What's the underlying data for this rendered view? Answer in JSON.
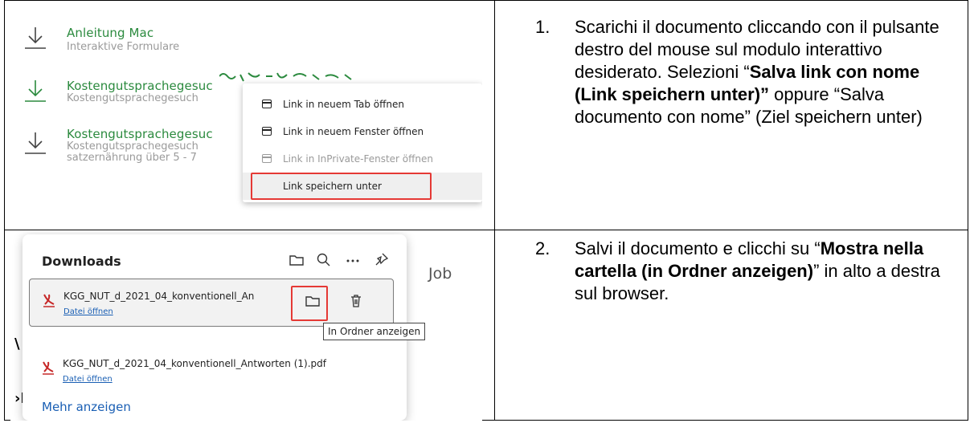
{
  "colors": {
    "accent_green": "#2b8a3e",
    "highlight_red": "#e53935",
    "link_blue": "#1a5fb4"
  },
  "screenshot1": {
    "downloads": [
      {
        "title": "Anleitung Mac",
        "subtitle_lines": [
          "Interaktive Formulare"
        ],
        "icon": "download-icon"
      },
      {
        "title": "Kostengutsprachegesuc",
        "subtitle_lines": [
          "Kostengutsprachegesuch"
        ],
        "icon": "download-icon"
      },
      {
        "title": "Kostengutsprachegesuc",
        "subtitle_lines": [
          "Kostengutsprachegesuch",
          "satzernährung über 5 - 7"
        ],
        "icon": "download-icon"
      }
    ],
    "context_menu": {
      "items": [
        {
          "label": "Link in neuem Tab öffnen",
          "icon": "tab-icon"
        },
        {
          "label": "Link in neuem Fenster öffnen",
          "icon": "window-icon"
        },
        {
          "label": "Link in InPrivate-Fenster öffnen",
          "icon": "inprivate-icon",
          "disabled": true
        },
        {
          "label": "Link speichern unter",
          "highlighted": true
        }
      ]
    }
  },
  "screenshot2": {
    "panel_title": "Downloads",
    "toolbar_icons": [
      "folder-icon",
      "search-icon",
      "more-icon",
      "pin-icon"
    ],
    "background_text": "Job",
    "files": [
      {
        "name": "KGG_NUT_d_2021_04_konventionell_An",
        "action": "Datei öffnen",
        "icon": "pdf-icon"
      },
      {
        "name": "KGG_NUT_d_2021_04_konventionell_Antworten (1).pdf",
        "action": "Datei öffnen",
        "icon": "pdf-icon"
      }
    ],
    "tooltip": "In Ordner anzeigen",
    "more_label": "Mehr anzeigen"
  },
  "instructions": [
    {
      "number": "1.",
      "part1": "Scarichi il documento cliccando con il pulsante destro del mouse sul modulo interattivo desiderato. Selezioni “",
      "bold": "Salva link con nome (Link speichern unter)”",
      "part2": " oppure “Salva documento con nome” (Ziel speichern unter)"
    },
    {
      "number": "2.",
      "part1": "Salvi il documento e clicchi su “",
      "bold": "Mostra nella cartella (in Ordner anzeigen)",
      "part2": "” in alto a destra sul browser."
    }
  ]
}
